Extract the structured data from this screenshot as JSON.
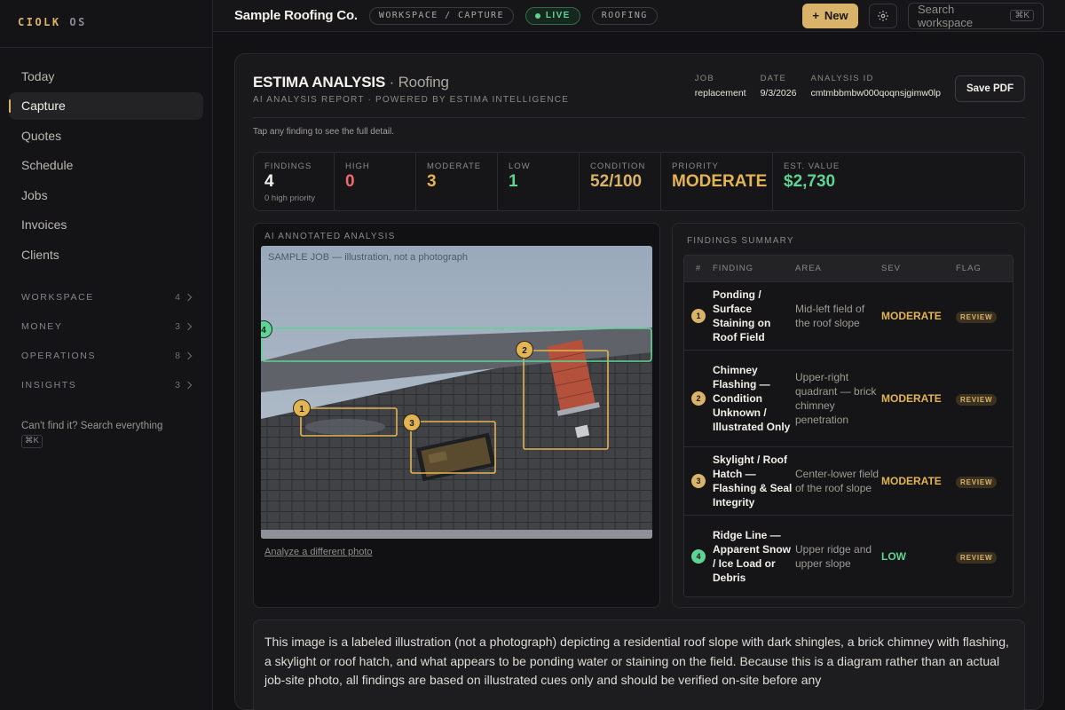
{
  "brand": {
    "part1": "CIOLK",
    "part2": "OS"
  },
  "sidebar": {
    "items": [
      {
        "label": "Today"
      },
      {
        "label": "Capture"
      },
      {
        "label": "Quotes"
      },
      {
        "label": "Schedule"
      },
      {
        "label": "Jobs"
      },
      {
        "label": "Invoices"
      },
      {
        "label": "Clients"
      }
    ],
    "active": "Capture",
    "groups": [
      {
        "label": "WORKSPACE",
        "count": "4"
      },
      {
        "label": "MONEY",
        "count": "3"
      },
      {
        "label": "OPERATIONS",
        "count": "8"
      },
      {
        "label": "INSIGHTS",
        "count": "3"
      }
    ],
    "search_hint": "Can't find it? Search everything",
    "search_shortcut": "⌘K"
  },
  "topbar": {
    "company": "Sample Roofing Co.",
    "breadcrumb": "WORKSPACE / CAPTURE",
    "live": "LIVE",
    "tag": "ROOFING",
    "new_label": "New",
    "search_placeholder": "Search workspace",
    "search_shortcut": "⌘K"
  },
  "report": {
    "title": "ESTIMA ANALYSIS",
    "title_sep": " · ",
    "subtitle": "Roofing",
    "caption": "AI ANALYSIS REPORT · POWERED BY ESTIMA INTELLIGENCE",
    "meta": [
      {
        "key": "JOB",
        "value": "replacement"
      },
      {
        "key": "DATE",
        "value": "9/3/2026"
      },
      {
        "key": "ANALYSIS ID",
        "value": "cmtmbbmbw000qoqnsjgimw0lp"
      }
    ],
    "save_pdf": "Save PDF",
    "hint": "Tap any finding to see the full detail."
  },
  "stats": [
    {
      "key": "FINDINGS",
      "value": "4",
      "sub": "0 high priority",
      "color": "#f2f0ea"
    },
    {
      "key": "HIGH",
      "value": "0",
      "sub": "",
      "color": "#ef6b6b"
    },
    {
      "key": "MODERATE",
      "value": "3",
      "sub": "",
      "color": "#e3b453"
    },
    {
      "key": "LOW",
      "value": "1",
      "sub": "",
      "color": "#5fd394"
    },
    {
      "key": "CONDITION",
      "value": "52/100",
      "sub": "",
      "color": "#d9b36a"
    },
    {
      "key": "PRIORITY",
      "value": "MODERATE",
      "sub": "",
      "color": "#e3b453"
    },
    {
      "key": "EST. VALUE",
      "value": "$2,730",
      "sub": "",
      "color": "#5fd394"
    }
  ],
  "image_panel": {
    "title": "AI ANNOTATED ANALYSIS",
    "image_caption": "SAMPLE JOB — illustration, not a photograph",
    "markers": [
      "1",
      "2",
      "3",
      "4"
    ],
    "analyze_link": "Analyze a different photo"
  },
  "summary": {
    "title": "FINDINGS SUMMARY",
    "columns": [
      "#",
      "FINDING",
      "AREA",
      "SEV",
      "FLAG"
    ],
    "rows": [
      {
        "num": "1",
        "finding": "Ponding / Surface Staining on Roof Field",
        "area": "Mid-left field of the roof slope",
        "sev": "MODERATE",
        "flag": "REVIEW"
      },
      {
        "num": "2",
        "finding": "Chimney Flashing — Condition Unknown / Illustrated Only",
        "area": "Upper-right quadrant — brick chimney penetration",
        "sev": "MODERATE",
        "flag": "REVIEW"
      },
      {
        "num": "3",
        "finding": "Skylight / Roof Hatch — Flashing & Seal Integrity",
        "area": "Center-lower field of the roof slope",
        "sev": "MODERATE",
        "flag": "REVIEW"
      },
      {
        "num": "4",
        "finding": "Ridge Line — Apparent Snow / Ice Load or Debris",
        "area": "Upper ridge and upper slope",
        "sev": "LOW",
        "flag": "REVIEW"
      }
    ]
  },
  "description": "This image is a labeled illustration (not a photograph) depicting a residential roof slope with dark shingles, a brick chimney with flashing, a skylight or roof hatch, and what appears to be ponding water or staining on the field. Because this is a diagram rather than an actual job-site photo, all findings are based on illustrated cues only and should be verified on-site before any"
}
